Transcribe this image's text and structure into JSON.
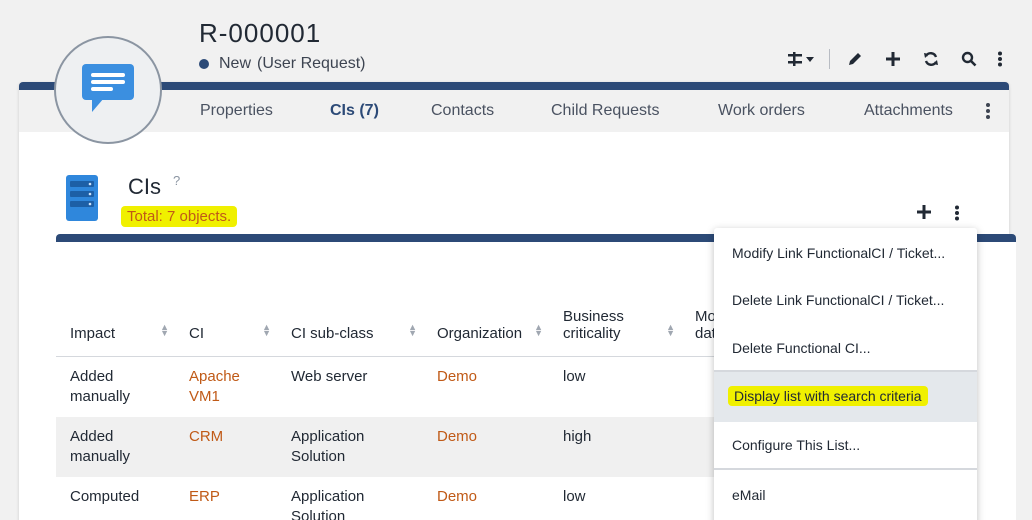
{
  "header": {
    "title": "R-000001",
    "status": "New",
    "status_detail": "(User Request)"
  },
  "toolbar": {
    "icons": [
      "transition-icon",
      "chevron-down-icon",
      "pencil-icon",
      "plus-icon",
      "refresh-icon",
      "search-icon",
      "more-vertical-icon"
    ]
  },
  "tabs": [
    {
      "label": "Properties"
    },
    {
      "label": "CIs (7)"
    },
    {
      "label": "Contacts"
    },
    {
      "label": "Child Requests"
    },
    {
      "label": "Work orders"
    },
    {
      "label": "Attachments"
    }
  ],
  "section": {
    "title": "CIs",
    "help": "?",
    "total": "Total: 7 objects."
  },
  "table": {
    "columns": [
      "Impact",
      "CI",
      "CI sub-class",
      "Organization",
      "Business criticality",
      "Mo dat"
    ],
    "rows": [
      {
        "impact": "Added manually",
        "ci": "Apache VM1",
        "subclass": "Web server",
        "org": "Demo",
        "criticality": "low"
      },
      {
        "impact": "Added manually",
        "ci": "CRM",
        "subclass": "Application Solution",
        "org": "Demo",
        "criticality": "high"
      },
      {
        "impact": "Computed",
        "ci": "ERP",
        "subclass": "Application Solution",
        "org": "Demo",
        "criticality": "low"
      }
    ]
  },
  "menu": {
    "items": [
      "Modify Link FunctionalCI / Ticket...",
      "Delete Link FunctionalCI / Ticket...",
      "Delete Functional CI...",
      "Display list with search criteria",
      "Configure This List...",
      "eMail"
    ]
  },
  "colors": {
    "brand": "#2c4a77",
    "link": "#c05a17",
    "highlight": "#f0f000"
  }
}
